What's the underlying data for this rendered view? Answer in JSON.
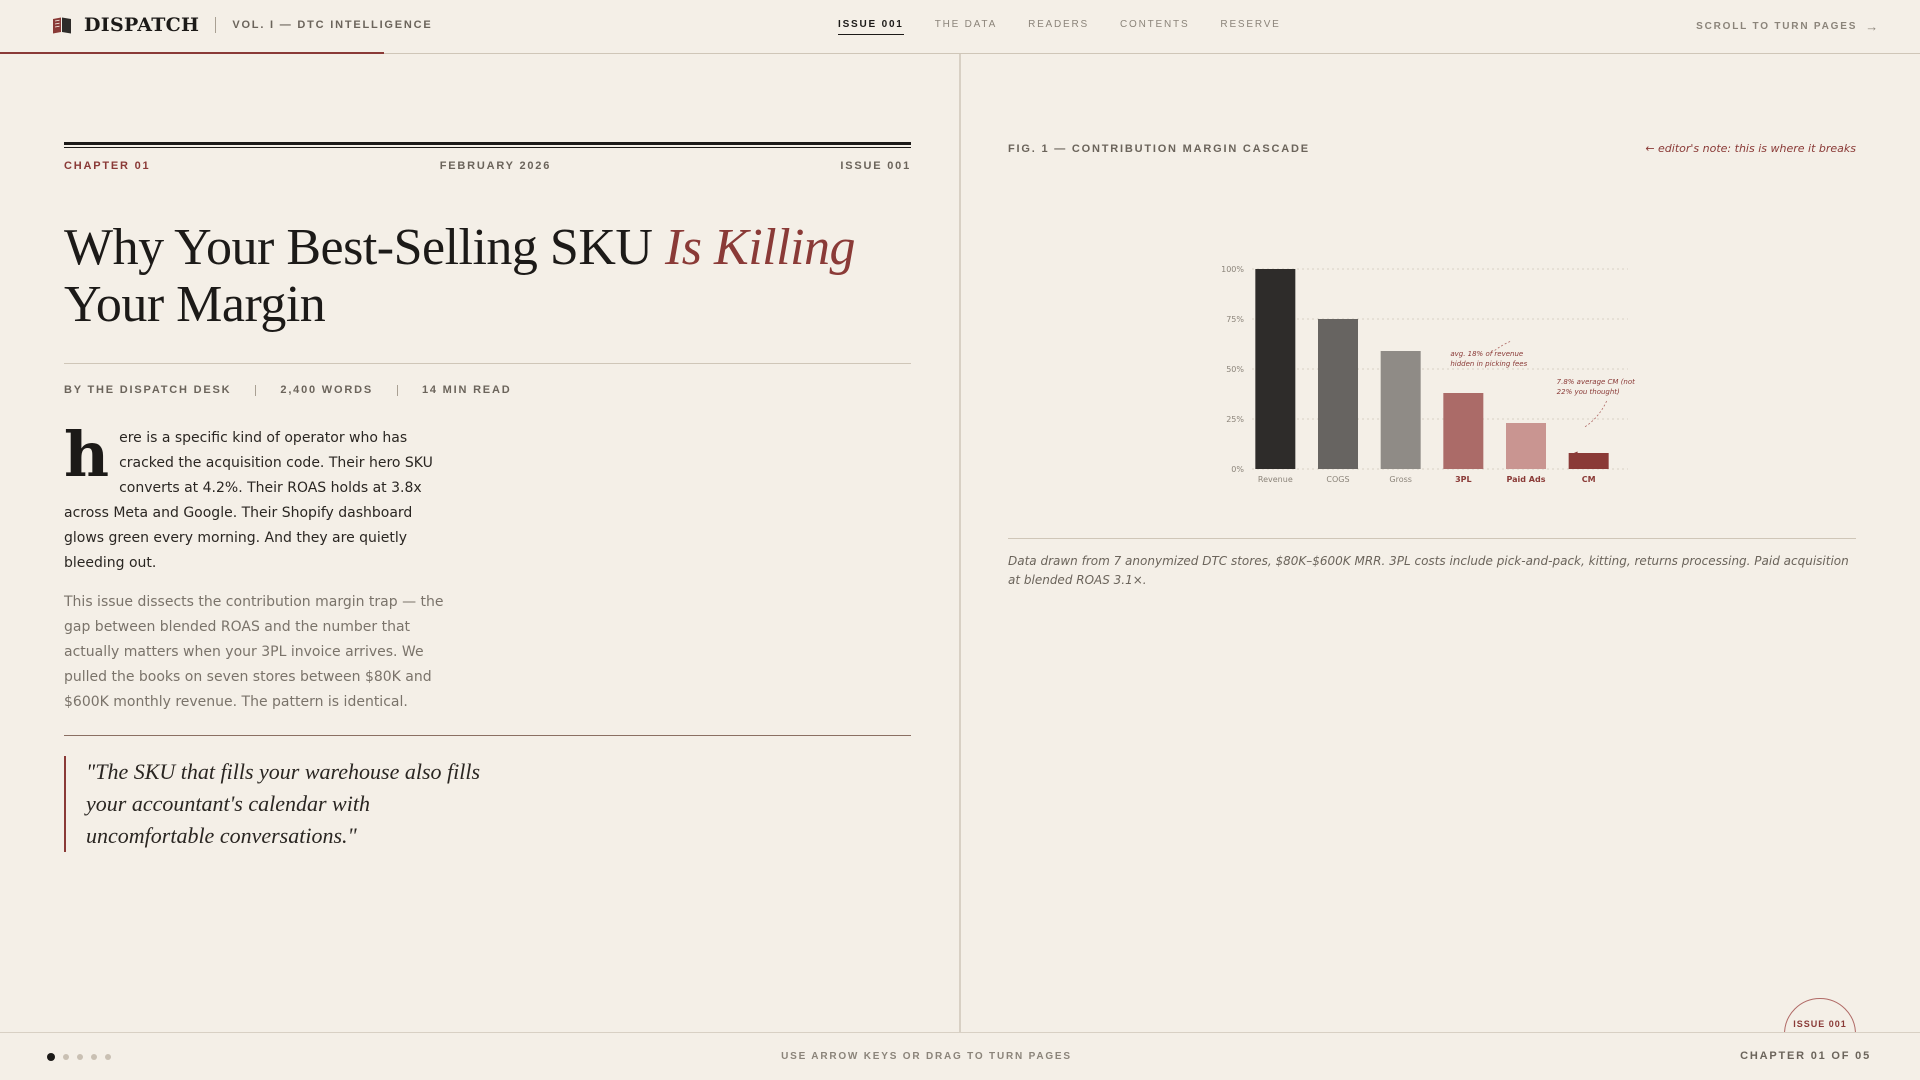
{
  "header": {
    "brand": "DISPATCH",
    "volume": "VOL. I — DTC INTELLIGENCE",
    "nav": [
      "ISSUE 001",
      "THE DATA",
      "READERS",
      "CONTENTS",
      "RESERVE"
    ],
    "scroll_hint": "SCROLL TO TURN PAGES",
    "colors": {
      "accent": "#8a3a37",
      "ink": "#1c1a18",
      "paper": "#f4efe7"
    }
  },
  "article": {
    "chapter": "CHAPTER 01",
    "date": "FEBRUARY 2026",
    "issue": "ISSUE 001",
    "headline_lead": "Why Your Best-Selling SKU ",
    "headline_accent": "Is Killing",
    "headline_tail": "Your Margin",
    "byline": "BY THE DISPATCH DESK",
    "words": "2,400 WORDS",
    "read_time": "14 MIN READ",
    "dropcap": "h",
    "lead": "ere is a specific kind of operator who has cracked the acquisition code. Their hero SKU converts at 4.2%. Their ROAS holds at 3.8x across Meta and Google. Their Shopify dashboard glows green every morning. And they are quietly bleeding out.",
    "second": "This issue dissects the contribution margin trap — the gap between blended ROAS and the number that actually matters when your 3PL invoice arrives. We pulled the books on seven stores between $80K and $600K monthly revenue. The pattern is identical.",
    "pullquote": "\"The SKU that fills your warehouse also fills your accountant's calendar with uncomfortable conversations.\""
  },
  "figure": {
    "title": "FIG. 1 — CONTRIBUTION MARGIN CASCADE",
    "editor_note": "← editor's note: this is where it breaks",
    "caption": "Data drawn from 7 anonymized DTC stores, $80K–$600K MRR. 3PL costs include pick-and-pack, kitting, returns processing. Paid acquisition at blended ROAS 3.1×."
  },
  "chart_data": {
    "type": "bar",
    "categories": [
      "Revenue",
      "COGS",
      "Gross",
      "3PL",
      "Paid Ads",
      "CM"
    ],
    "values": [
      100,
      75,
      59,
      38,
      23,
      8
    ],
    "ylim": [
      0,
      100
    ],
    "y_ticks": [
      "0%",
      "25%",
      "50%",
      "75%",
      "100%"
    ],
    "grid": true,
    "bold_categories": [
      "3PL",
      "Paid Ads",
      "CM"
    ],
    "bar_colors": [
      "#2e2c2a",
      "#676461",
      "#8f8b86",
      "#ab6b68",
      "#c99591",
      "#8a3a37"
    ],
    "annotations": [
      {
        "text": "avg. 18% of revenue hidden in picking fees",
        "target": "3PL"
      },
      {
        "text": "7.8% average CM (not 22% you thought)",
        "target": "CM"
      }
    ]
  },
  "footer": {
    "hint": "USE ARROW KEYS OR DRAG TO TURN PAGES",
    "chapter": "CHAPTER 01 OF 05",
    "page_count": 5,
    "active_page": 1,
    "stamp": "ISSUE 001"
  }
}
